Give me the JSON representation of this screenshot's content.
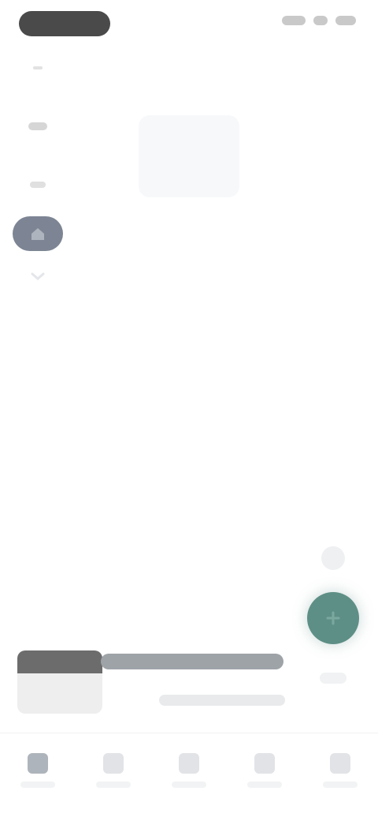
{
  "status_bar": {
    "left_pill": "",
    "right_icons": [
      "signal-icon",
      "wifi-icon",
      "battery-icon"
    ]
  },
  "side_menu": {
    "items": [
      {
        "name": "menu-item-1",
        "icon": "dot-icon",
        "active": false
      },
      {
        "name": "menu-item-2",
        "icon": "grid-icon",
        "active": false
      },
      {
        "name": "menu-item-3",
        "icon": "list-icon",
        "active": false
      },
      {
        "name": "menu-item-4",
        "icon": "home-icon",
        "active": true
      },
      {
        "name": "menu-item-5",
        "icon": "chevron-down-icon",
        "active": false
      }
    ]
  },
  "fab": {
    "icon": "add-icon"
  },
  "now_playing": {
    "title": "",
    "subtitle": ""
  },
  "bottom_nav": {
    "items": [
      {
        "icon": "home-icon",
        "active": true
      },
      {
        "icon": "search-icon",
        "active": false
      },
      {
        "icon": "library-icon",
        "active": false
      },
      {
        "icon": "bell-icon",
        "active": false
      },
      {
        "icon": "profile-icon",
        "active": false
      }
    ]
  },
  "colors": {
    "accent": "#5e8f86",
    "active_chip": "#7d8594",
    "pill": "#4a4a4a"
  }
}
